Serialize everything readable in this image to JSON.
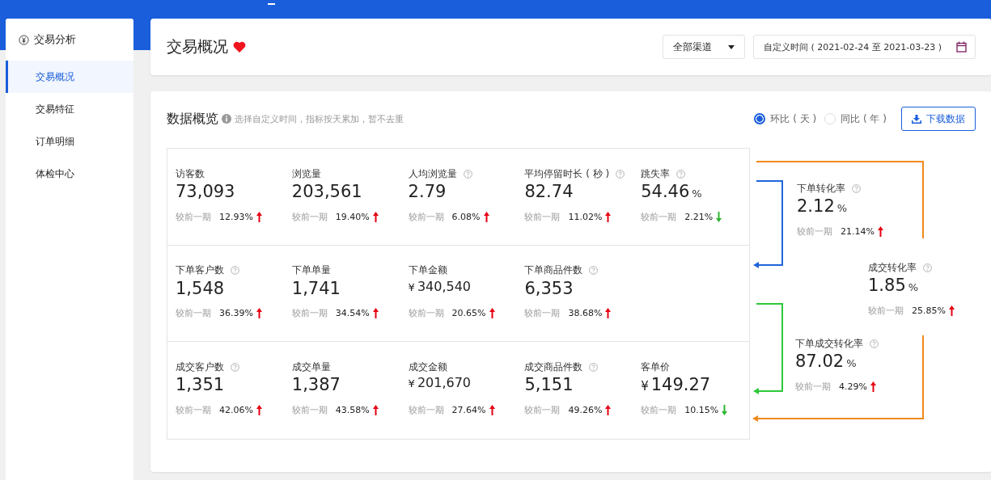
{
  "sidebar": {
    "title": "交易分析",
    "items": [
      {
        "label": "交易概况",
        "selected": true
      },
      {
        "label": "交易特征",
        "selected": false
      },
      {
        "label": "订单明细",
        "selected": false
      },
      {
        "label": "体检中心",
        "selected": false
      }
    ]
  },
  "header": {
    "title": "交易概况",
    "channel": "全部渠道",
    "date_range": "自定义时间 ( 2021-02-24 至 2021-03-23 )"
  },
  "overview": {
    "title": "数据概览",
    "hint": "选择自定义时间，指标按天累加，暂不去重",
    "compare_options": [
      {
        "label": "环比 ( 天 )",
        "selected": true
      },
      {
        "label": "同比 ( 年 )",
        "selected": false
      }
    ],
    "download_button": "下载数据",
    "rows": [
      [
        {
          "label": "访客数",
          "help": false,
          "value": "73,093",
          "change_label": "较前一期",
          "change": "12.93%",
          "rising": true
        },
        {
          "label": "浏览量",
          "help": false,
          "value": "203,561",
          "change_label": "较前一期",
          "change": "19.40%",
          "rising": true
        },
        {
          "label": "人均浏览量",
          "help": true,
          "value": "2.79",
          "change_label": "较前一期",
          "change": "6.08%",
          "rising": true
        },
        {
          "label": "平均停留时长 ( 秒 )",
          "help": true,
          "value": "82.74",
          "change_label": "较前一期",
          "change": "11.02%",
          "rising": true
        },
        {
          "label": "跳失率",
          "help": true,
          "value": "54.46",
          "unit": "%",
          "change_label": "较前一期",
          "change": "2.21%",
          "rising": false
        }
      ],
      [
        {
          "label": "下单客户数",
          "help": true,
          "value": "1,548",
          "change_label": "较前一期",
          "change": "36.39%",
          "rising": true
        },
        {
          "label": "下单单量",
          "help": false,
          "value": "1,741",
          "change_label": "较前一期",
          "change": "34.54%",
          "rising": true
        },
        {
          "label": "下单金额",
          "help": false,
          "prefix": "¥",
          "value": "340,540",
          "change_label": "较前一期",
          "change": "20.65%",
          "rising": true
        },
        {
          "label": "下单商品件数",
          "help": true,
          "value": "6,353",
          "change_label": "较前一期",
          "change": "38.68%",
          "rising": true
        }
      ],
      [
        {
          "label": "成交客户数",
          "help": true,
          "value": "1,351",
          "change_label": "较前一期",
          "change": "42.06%",
          "rising": true
        },
        {
          "label": "成交单量",
          "help": false,
          "value": "1,387",
          "change_label": "较前一期",
          "change": "43.58%",
          "rising": true
        },
        {
          "label": "成交金额",
          "help": false,
          "prefix": "¥",
          "value": "201,670",
          "change_label": "较前一期",
          "change": "27.64%",
          "rising": true
        },
        {
          "label": "成交商品件数",
          "help": true,
          "value": "5,151",
          "change_label": "较前一期",
          "change": "49.26%",
          "rising": true
        },
        {
          "label": "客单价",
          "help": false,
          "prefix": "¥",
          "value": "149.27",
          "change_label": "较前一期",
          "change": "10.15%",
          "rising": false
        }
      ]
    ],
    "funnel": [
      {
        "label": "下单转化率",
        "value": "2.12",
        "unit": "%",
        "change_label": "较前一期",
        "change": "21.14%",
        "rising": true
      },
      {
        "label": "成交转化率",
        "value": "1.85",
        "unit": "%",
        "change_label": "较前一期",
        "change": "25.85%",
        "rising": true
      },
      {
        "label": "下单成交转化率",
        "value": "87.02",
        "unit": "%",
        "change_label": "较前一期",
        "change": "4.29%",
        "rising": true
      }
    ]
  }
}
